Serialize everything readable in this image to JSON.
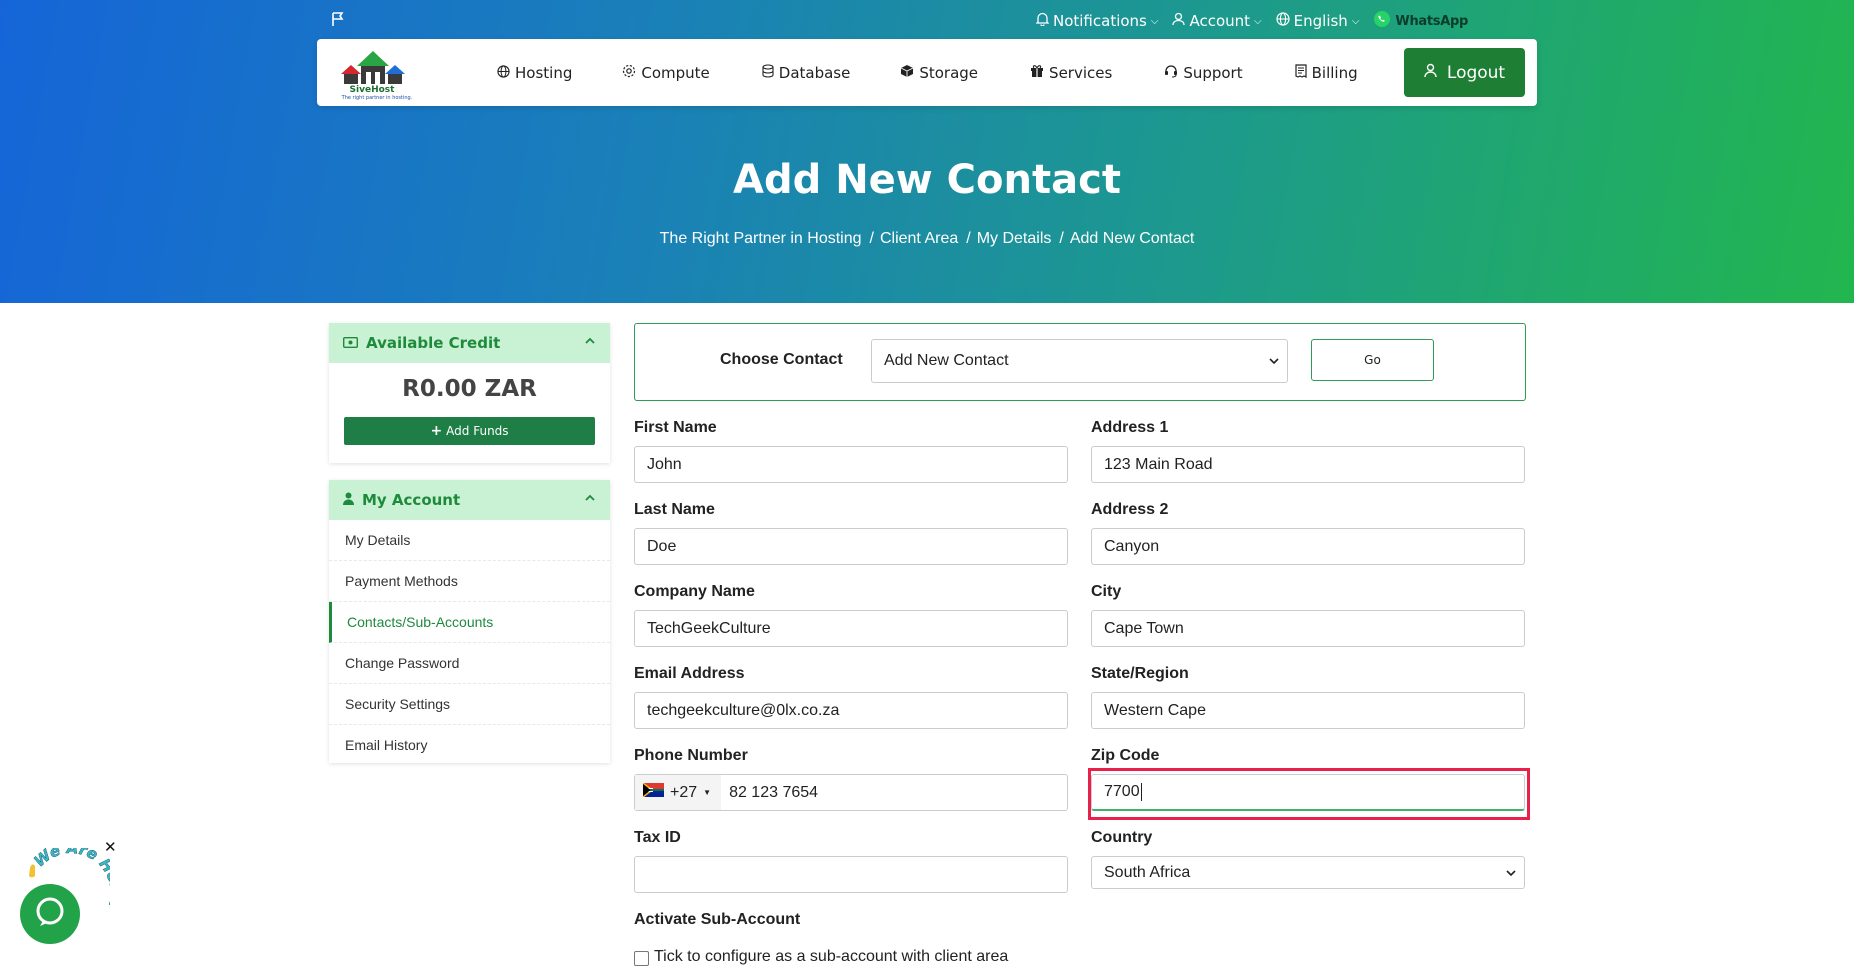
{
  "topbar": {
    "notifications": "Notifications",
    "account": "Account",
    "language": "English",
    "whatsapp": "WhatsApp"
  },
  "logo": {
    "name": "SiveHost",
    "tagline": "The right partner in hosting."
  },
  "nav": {
    "hosting": "Hosting",
    "compute": "Compute",
    "database": "Database",
    "storage": "Storage",
    "services": "Services",
    "support": "Support",
    "billing": "Billing",
    "logout": "Logout"
  },
  "hero": {
    "title": "Add New Contact",
    "breadcrumb": [
      "The Right Partner in Hosting",
      "Client Area",
      "My Details",
      "Add New Contact"
    ]
  },
  "sidebar": {
    "credit": {
      "title": "Available Credit",
      "value": "R0.00 ZAR",
      "add_funds": "Add Funds"
    },
    "account": {
      "title": "My Account",
      "items": [
        "My Details",
        "Payment Methods",
        "Contacts/Sub-Accounts",
        "Change Password",
        "Security Settings",
        "Email History"
      ],
      "active_index": 2
    }
  },
  "choose_contact": {
    "label": "Choose Contact",
    "selected": "Add New Contact",
    "go": "Go"
  },
  "form": {
    "first_name": {
      "label": "First Name",
      "value": "John"
    },
    "last_name": {
      "label": "Last Name",
      "value": "Doe"
    },
    "company": {
      "label": "Company Name",
      "value": "TechGeekCulture"
    },
    "email": {
      "label": "Email Address",
      "value": "techgeekculture@0lx.co.za"
    },
    "phone": {
      "label": "Phone Number",
      "code": "+27",
      "value": "82 123 7654"
    },
    "tax_id": {
      "label": "Tax ID",
      "value": ""
    },
    "address1": {
      "label": "Address 1",
      "value": "123 Main Road"
    },
    "address2": {
      "label": "Address 2",
      "value": "Canyon"
    },
    "city": {
      "label": "City",
      "value": "Cape Town"
    },
    "state": {
      "label": "State/Region",
      "value": "Western Cape"
    },
    "zip": {
      "label": "Zip Code",
      "value": "7700"
    },
    "country": {
      "label": "Country",
      "value": "South Africa"
    },
    "activate": {
      "label": "Activate Sub-Account",
      "checkbox_label": "Tick to configure as a sub-account with client area"
    }
  },
  "chat": {
    "badge": "We Are Here!"
  },
  "colors": {
    "accent_green": "#1e7e34",
    "highlight_red": "#e8214a",
    "panel_green": "#c9f1d3"
  }
}
